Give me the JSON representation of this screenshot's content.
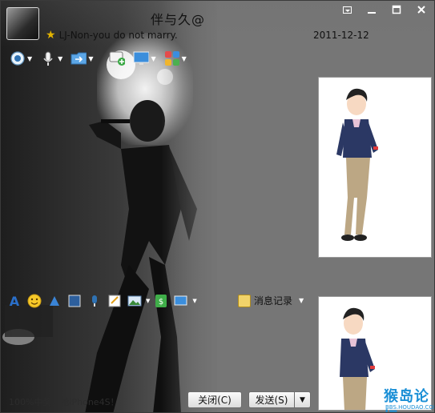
{
  "header": {
    "nickname": "伴与久@",
    "signature": "LJ-Non-you do not marry.",
    "date": "2011-12-12"
  },
  "window_controls": [
    "menu",
    "minimize",
    "maximize",
    "close"
  ],
  "toolbar": {
    "items": [
      {
        "name": "video-call",
        "icon": "camera-icon"
      },
      {
        "name": "voice-call",
        "icon": "microphone-icon"
      },
      {
        "name": "send-file",
        "icon": "folder-icon"
      },
      {
        "name": "create-group",
        "icon": "chat-add-icon"
      },
      {
        "name": "remote-assist",
        "icon": "monitor-icon"
      },
      {
        "name": "apps",
        "icon": "apps-grid-icon"
      }
    ]
  },
  "format_toolbar": {
    "items": [
      "font-icon",
      "emoji-icon",
      "shake-icon",
      "screen-icon",
      "voice-message-icon",
      "note-icon",
      "image-icon",
      "money-icon",
      "screenshot-icon"
    ],
    "message_log_label": "消息记录"
  },
  "footer": {
    "status_text": "100%中奖，抢iPhone4S！",
    "close_label": "关闭(C)",
    "send_label": "发送(S)"
  },
  "watermark": {
    "title": "猴岛论坛",
    "subtitle": "BBS.HOUDAO.COM"
  },
  "colors": {
    "window_bg": "#767676",
    "button_bg": "#efefef",
    "star": "#e3b400",
    "watermark": "#1a8fd6"
  }
}
